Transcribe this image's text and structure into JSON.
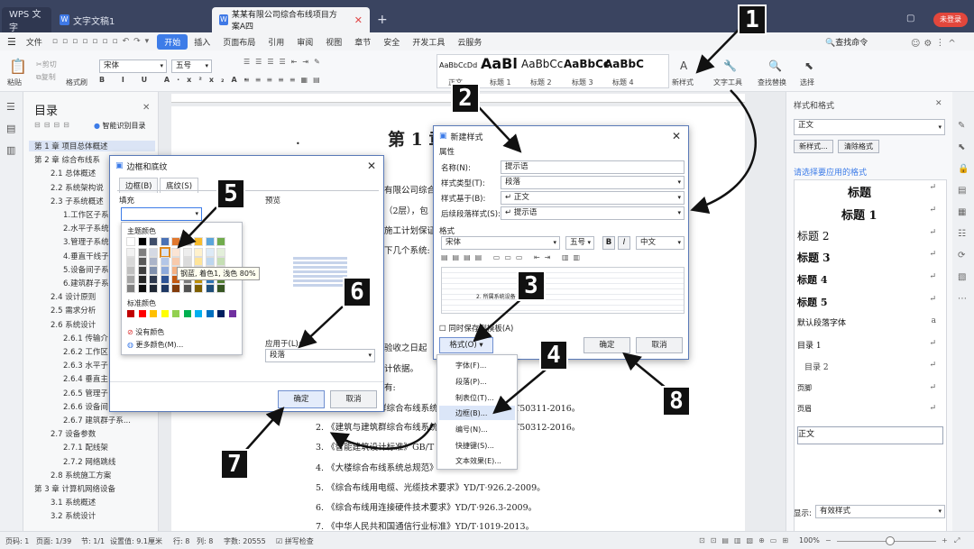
{
  "titlebar": {
    "tabs": [
      {
        "label": "WPS 文字"
      },
      {
        "label": "文字文稿1"
      },
      {
        "label": "某某有限公司综合布线项目方案A四"
      }
    ],
    "new_tab": "+",
    "login_button": "未登录"
  },
  "menubar": {
    "file": "文件",
    "items": [
      "开始",
      "插入",
      "页面布局",
      "引用",
      "审阅",
      "视图",
      "章节",
      "安全",
      "开发工具",
      "云服务"
    ],
    "search": "查找命令"
  },
  "ribbon": {
    "paste": "粘贴",
    "cut": "剪切",
    "copy": "复制",
    "format_painter": "格式刷",
    "font": "宋体",
    "size": "五号",
    "styles": [
      {
        "sample": "AaBbCcDd",
        "label": "正文"
      },
      {
        "sample": "AaBl",
        "label": "标题 1"
      },
      {
        "sample": "AaBbCc",
        "label": "标题 2"
      },
      {
        "sample": "AaBbCc",
        "label": "标题 3"
      },
      {
        "sample": "AaBbC",
        "label": "标题 4"
      }
    ],
    "new_style": "新样式",
    "text_tools": "文字工具",
    "find_replace": "查找替换",
    "select": "选择"
  },
  "toc": {
    "title": "目录",
    "smart_toc": "智能识别目录",
    "items": [
      {
        "text": "第 1 章  项目总体概述",
        "level": 0
      },
      {
        "text": "第 2 章  综合布线系",
        "level": 0
      },
      {
        "text": "2.1  总体概述",
        "level": 1
      },
      {
        "text": "2.2  系统架构说",
        "level": 1
      },
      {
        "text": "2.3  子系统概述",
        "level": 1
      },
      {
        "text": "1.工作区子系",
        "level": 2
      },
      {
        "text": "2.水平子系统",
        "level": 2
      },
      {
        "text": "3.管理子系统",
        "level": 2
      },
      {
        "text": "4.垂直干线子",
        "level": 2
      },
      {
        "text": "5.设备间子系",
        "level": 2
      },
      {
        "text": "6.建筑群子系",
        "level": 2
      },
      {
        "text": "2.4  设计原则",
        "level": 1
      },
      {
        "text": "2.5  需求分析",
        "level": 1
      },
      {
        "text": "2.6  系统设计",
        "level": 1
      },
      {
        "text": "2.6.1  传输介",
        "level": 2
      },
      {
        "text": "2.6.2  工作区",
        "level": 2
      },
      {
        "text": "2.6.3  水平子",
        "level": 2
      },
      {
        "text": "2.6.4  垂直主",
        "level": 2
      },
      {
        "text": "2.6.5  管理子",
        "level": 2
      },
      {
        "text": "2.6.6  设备间",
        "level": 2
      },
      {
        "text": "2.6.7  建筑群子系...",
        "level": 2
      },
      {
        "text": "2.7  设备参数",
        "level": 1
      },
      {
        "text": "2.7.1  配线架",
        "level": 2
      },
      {
        "text": "2.7.2  网络跳线",
        "level": 2
      },
      {
        "text": "2.8  系统施工方案",
        "level": 1
      },
      {
        "text": "第 3 章  计算机网络设备",
        "level": 0
      },
      {
        "text": "3.1  系统概述",
        "level": 1
      },
      {
        "text": "3.2  系统设计",
        "level": 1
      }
    ]
  },
  "document": {
    "heading": "第 1 章",
    "fragments": [
      "有限公司综合",
      "（2层），包",
      "施工计划保证",
      "下几个系统:",
      "验收之日起",
      "计依据。",
      "有:"
    ],
    "refs": [
      "1. 《建筑与建筑群综合布线系统工程设计规范》GB/T50311-2016。",
      "2. 《建筑与建筑群综合布线系统工程验收规范》GB/T50312-2016。",
      "3. 《智能建筑设计标准》GB/T",
      "4. 《大楼综合布线系统总规范》",
      "5. 《综合布线用电缆、光缆技术要求》YD/T·926.2-2009。",
      "6. 《综合布线用连接硬件技术要求》YD/T·926.3-2009。",
      "7. 《中华人民共和国通信行业标准》YD/T·1019-2013。"
    ]
  },
  "border_dialog": {
    "title": "边框和底纹",
    "tabs": [
      "边框(B)",
      "底纹(S)"
    ],
    "fill_label": "填充",
    "theme_colors": "主题颜色",
    "tooltip": "钢蓝, 着色1, 浅色 80%",
    "standard_colors": "标准颜色",
    "no_color": "没有颜色",
    "more_colors": "更多颜色(M)...",
    "preview_label": "预览",
    "apply_to_label": "应用于(L):",
    "apply_to_value": "段落",
    "ok": "确定",
    "cancel": "取消",
    "theme_palette": [
      [
        "#ffffff",
        "#000000",
        "#404e69",
        "#4a72b6",
        "#e0782f",
        "#a5a5a5",
        "#f8bc2c",
        "#5ba5db",
        "#71ac4d"
      ],
      [
        "#f2f2f2",
        "#7f7f7f",
        "#d5d9e4",
        "#d8e2f2",
        "#fbe4d4",
        "#ededed",
        "#fff1cc",
        "#ddeaf6",
        "#e3efda"
      ],
      [
        "#d8d8d8",
        "#595959",
        "#abb4c9",
        "#b3c6e7",
        "#f7caac",
        "#dbdbdb",
        "#fee499",
        "#bdd6ee",
        "#c5dfb4"
      ],
      [
        "#bfbfbf",
        "#3f3f3f",
        "#8191ae",
        "#8eaadb",
        "#f4b183",
        "#c9c9c9",
        "#ffd866",
        "#9cc3e5",
        "#a8d08d"
      ],
      [
        "#a5a5a5",
        "#262626",
        "#2f3a4f",
        "#2f5496",
        "#c45a11",
        "#7b7b7b",
        "#bf8f00",
        "#2e74b5",
        "#538135"
      ],
      [
        "#7f7f7f",
        "#0c0c0c",
        "#1f2734",
        "#1f3864",
        "#833c0b",
        "#525252",
        "#7f6000",
        "#1f4e79",
        "#375623"
      ]
    ],
    "standard_palette": [
      "#c00000",
      "#ff0000",
      "#ffc000",
      "#ffff00",
      "#92d050",
      "#00b050",
      "#00b0f0",
      "#0070c0",
      "#002060",
      "#7030a0"
    ]
  },
  "new_style_dialog": {
    "title": "新建样式",
    "properties": "属性",
    "name_label": "名称(N):",
    "name_value": "提示语",
    "type_label": "样式类型(T):",
    "type_value": "段落",
    "based_label": "样式基于(B):",
    "based_value": "↵ 正文",
    "next_label": "后续段落样式(S):",
    "next_value": "↵ 提示语",
    "format_label": "格式",
    "font": "宋体",
    "size": "五号",
    "bold": "B",
    "italic": "I",
    "lang": "中文",
    "preview_text": "2.  所属系统设备",
    "add_template": "同时保存到模板(A)",
    "format_button": "格式(O)",
    "ok": "确定",
    "cancel": "取消"
  },
  "format_menu": {
    "items": [
      "字体(F)...",
      "段落(P)...",
      "制表位(T)...",
      "边框(B)...",
      "编号(N)...",
      "快捷键(S)...",
      "文本效果(E)..."
    ]
  },
  "style_panel": {
    "title": "样式和格式",
    "current": "正文",
    "new_style": "新样式...",
    "clear_format": "清除格式",
    "apply_label": "请选择要应用的格式",
    "styles": [
      "标题",
      "标题  1",
      "标题  2",
      "标题  3",
      "标题  4",
      "标题  5",
      "默认段落字体",
      "目录  1",
      "目录  2",
      "页脚",
      "页眉",
      "正文"
    ],
    "show_label": "显示:",
    "show_value": "有效样式"
  },
  "callouts": [
    "1",
    "2",
    "3",
    "4",
    "5",
    "6",
    "7",
    "8"
  ],
  "status": {
    "page_num": "页码: 1",
    "pages": "页面: 1/39",
    "section": "节: 1/1",
    "setting": "设置值: 9.1厘米",
    "row": "行: 8",
    "col": "列: 8",
    "words": "字数: 20555",
    "spell": "拼写检查",
    "zoom": "100%"
  },
  "colors": {
    "accent": "#3d7ce8",
    "titlebar": "#3a4460",
    "dialog_border": "#5a7ab8"
  }
}
